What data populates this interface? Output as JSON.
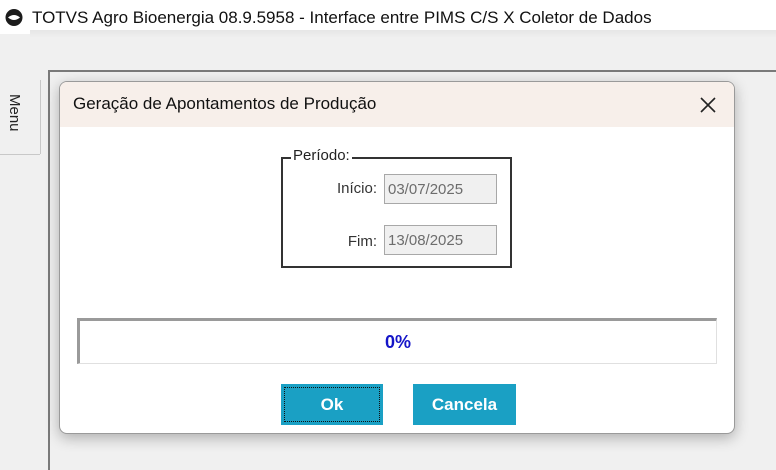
{
  "app": {
    "icon": "totvs-logo-icon",
    "title": "TOTVS Agro Bioenergia 08.9.5958 - Interface entre PIMS C/S X Coletor de Dados"
  },
  "side_menu": {
    "label": "Menu"
  },
  "dialog": {
    "title": "Geração de Apontamentos de Produção",
    "close_icon": "close-icon",
    "period": {
      "legend": "Período:",
      "start_label": "Início:",
      "start_value": "03/07/2025",
      "end_label": "Fim:",
      "end_value": "13/08/2025"
    },
    "progress": {
      "value": 0,
      "text": "0%"
    },
    "buttons": {
      "ok_label": "Ok",
      "cancel_label": "Cancela"
    }
  },
  "colors": {
    "button": "#1aa0c4",
    "progress_text": "#1515c8",
    "dialog_title_bg": "#f7efea"
  }
}
